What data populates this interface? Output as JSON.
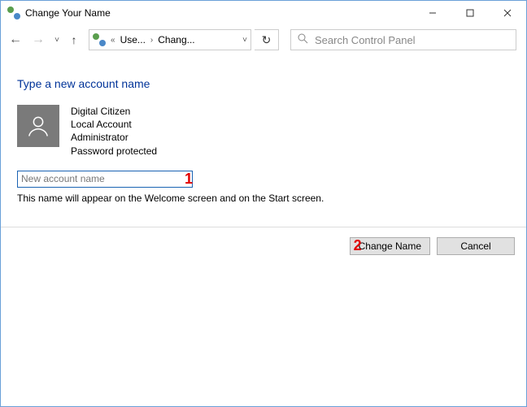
{
  "window": {
    "title": "Change Your Name"
  },
  "breadcrumb": {
    "seg1": "Use...",
    "seg2": "Chang..."
  },
  "search": {
    "placeholder": "Search Control Panel"
  },
  "page": {
    "heading": "Type a new account name",
    "account_name": "Digital Citizen",
    "account_type": "Local Account",
    "account_role": "Administrator",
    "password_state": "Password protected",
    "input_placeholder": "New account name",
    "hint": "This name will appear on the Welcome screen and on the Start screen."
  },
  "callouts": {
    "one": "1",
    "two": "2"
  },
  "buttons": {
    "change": "Change Name",
    "cancel": "Cancel"
  }
}
